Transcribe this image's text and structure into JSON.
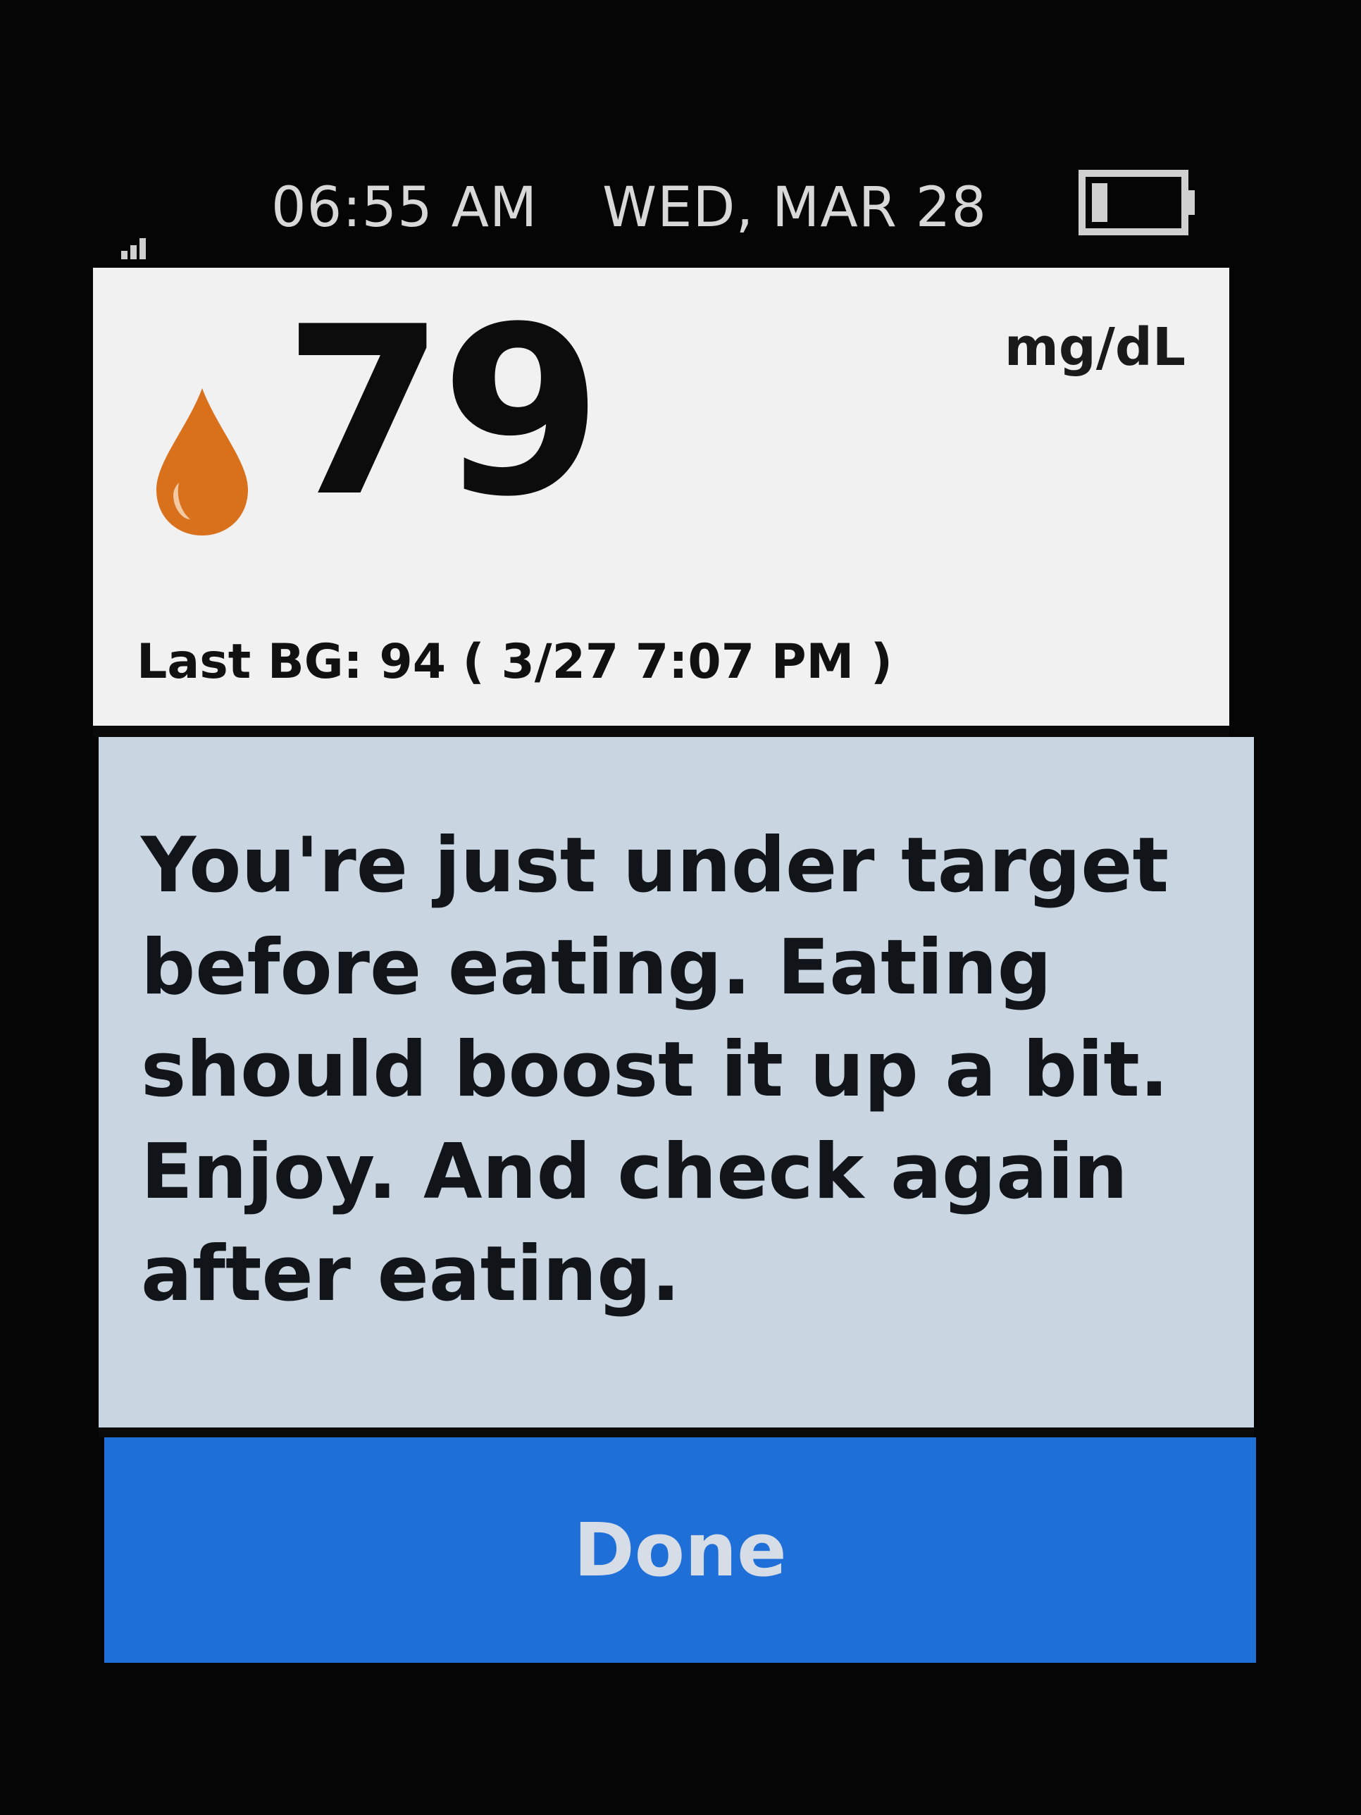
{
  "status_bar": {
    "time": "06:55 AM",
    "date": "WED, MAR 28",
    "signal_icon": "signal-strength-icon",
    "battery_icon": "battery-icon"
  },
  "reading": {
    "value": "79",
    "unit": "mg/dL",
    "icon": "blood-drop-icon",
    "last_bg": "Last BG: 94 ( 3/27  7:07 PM )"
  },
  "message": {
    "text": "You're just under target before eating. Eating should boost it up a bit. Enjoy. And check again after eating."
  },
  "actions": {
    "done_label": "Done"
  },
  "colors": {
    "drop": "#d9701c",
    "reading_bg": "#f1f1f1",
    "message_bg": "#c9d6e2",
    "button_bg": "#1f6fd8",
    "button_text": "#d7dde6",
    "screen_bezel": "#050506"
  }
}
